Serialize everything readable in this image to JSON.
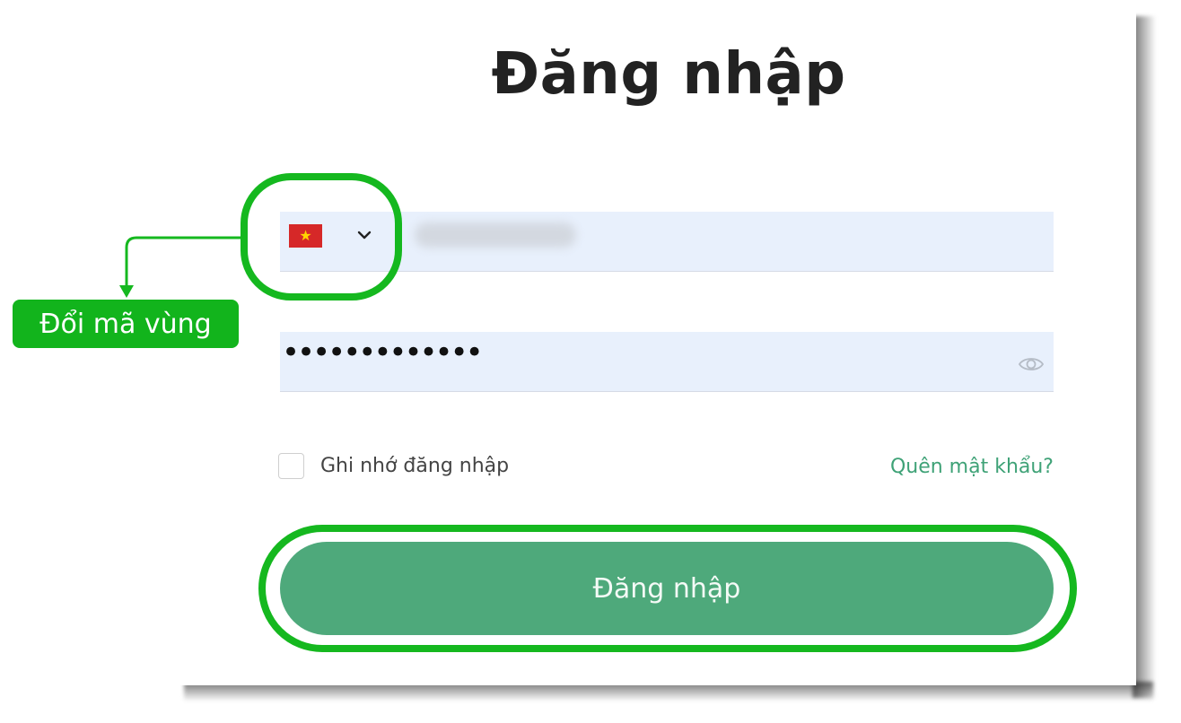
{
  "form": {
    "title": "Đăng nhập",
    "phone": {
      "country_flag": "vietnam-flag-icon",
      "flag_star": "★",
      "placeholder": "",
      "value": ""
    },
    "password": {
      "masked_value": "•••••••••••••"
    },
    "remember_label": "Ghi nhớ đăng nhập",
    "remember_checked": false,
    "forgot_label": "Quên mật khẩu?",
    "submit_label": "Đăng nhập"
  },
  "annotations": {
    "country_code_callout": "Đổi mã vùng",
    "highlight_color": "#15b81f"
  },
  "colors": {
    "field_bg": "#e8f0fc",
    "accent_green": "#4ea97b",
    "link_green": "#3fa277",
    "title_text": "#222222"
  }
}
